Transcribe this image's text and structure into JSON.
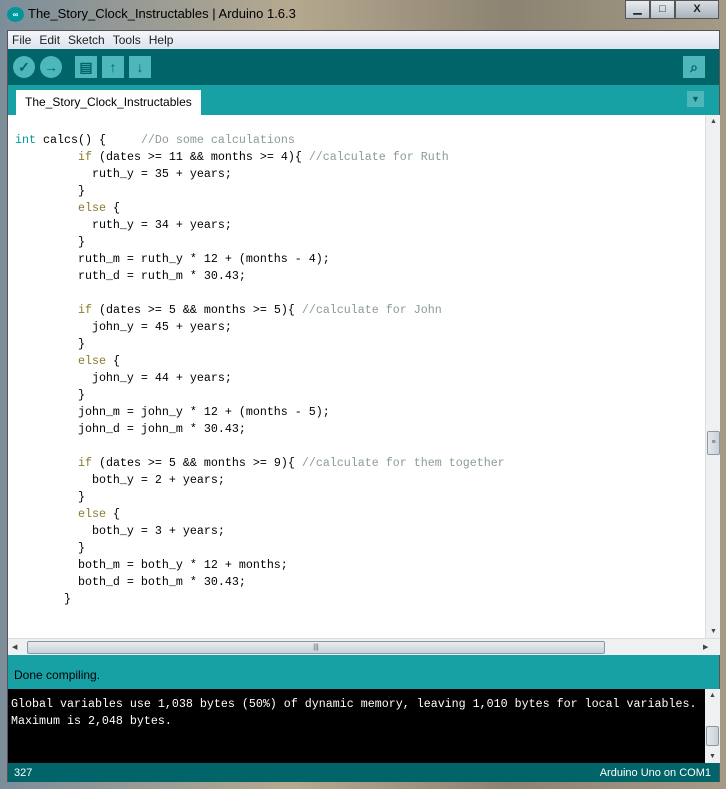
{
  "window": {
    "title": "The_Story_Clock_Instructables | Arduino 1.6.3",
    "icon": "arduino-logo-icon",
    "minimize": "▁",
    "maximize": "□",
    "close": "X"
  },
  "menu": [
    "File",
    "Edit",
    "Sketch",
    "Tools",
    "Help"
  ],
  "toolbar": {
    "verify": "✓",
    "upload": "→",
    "new": "▤",
    "open": "↑",
    "save": "↓",
    "serial_monitor": "⌕"
  },
  "tab": {
    "label": "The_Story_Clock_Instructables",
    "menu_icon": "▼"
  },
  "code": [
    [
      {
        "t": "int",
        "c": "k-type"
      },
      {
        "t": " calcs() {     "
      },
      {
        "t": "//Do some calculations",
        "c": "k-com"
      }
    ],
    [
      {
        "t": "         "
      },
      {
        "t": "if",
        "c": "k-kw"
      },
      {
        "t": " (dates >= 11 && months >= 4){ "
      },
      {
        "t": "//calculate for Ruth",
        "c": "k-com"
      }
    ],
    [
      {
        "t": "           ruth_y = 35 + years;"
      }
    ],
    [
      {
        "t": "         }"
      }
    ],
    [
      {
        "t": "         "
      },
      {
        "t": "else",
        "c": "k-kw"
      },
      {
        "t": " {"
      }
    ],
    [
      {
        "t": "           ruth_y = 34 + years;"
      }
    ],
    [
      {
        "t": "         }"
      }
    ],
    [
      {
        "t": "         ruth_m = ruth_y * 12 + (months - 4);"
      }
    ],
    [
      {
        "t": "         ruth_d = ruth_m * 30.43;"
      }
    ],
    [
      {
        "t": ""
      }
    ],
    [
      {
        "t": "         "
      },
      {
        "t": "if",
        "c": "k-kw"
      },
      {
        "t": " (dates >= 5 && months >= 5){ "
      },
      {
        "t": "//calculate for John",
        "c": "k-com"
      }
    ],
    [
      {
        "t": "           john_y = 45 + years;"
      }
    ],
    [
      {
        "t": "         }"
      }
    ],
    [
      {
        "t": "         "
      },
      {
        "t": "else",
        "c": "k-kw"
      },
      {
        "t": " {"
      }
    ],
    [
      {
        "t": "           john_y = 44 + years;"
      }
    ],
    [
      {
        "t": "         }"
      }
    ],
    [
      {
        "t": "         john_m = john_y * 12 + (months - 5);"
      }
    ],
    [
      {
        "t": "         john_d = john_m * 30.43;"
      }
    ],
    [
      {
        "t": ""
      }
    ],
    [
      {
        "t": "         "
      },
      {
        "t": "if",
        "c": "k-kw"
      },
      {
        "t": " (dates >= 5 && months >= 9){ "
      },
      {
        "t": "//calculate for them together",
        "c": "k-com"
      }
    ],
    [
      {
        "t": "           both_y = 2 + years;"
      }
    ],
    [
      {
        "t": "         }"
      }
    ],
    [
      {
        "t": "         "
      },
      {
        "t": "else",
        "c": "k-kw"
      },
      {
        "t": " {"
      }
    ],
    [
      {
        "t": "           both_y = 3 + years;"
      }
    ],
    [
      {
        "t": "         }"
      }
    ],
    [
      {
        "t": "         both_m = both_y * 12 + months;"
      }
    ],
    [
      {
        "t": "         both_d = both_m * 30.43;"
      }
    ],
    [
      {
        "t": "       }"
      }
    ]
  ],
  "status": {
    "message": "Done compiling."
  },
  "console": {
    "text": "Global variables use 1,038 bytes (50%) of dynamic memory, leaving 1,010 bytes for local variables. Maximum is 2,048 bytes."
  },
  "footer": {
    "line": "327",
    "board": "Arduino Uno on COM1"
  }
}
